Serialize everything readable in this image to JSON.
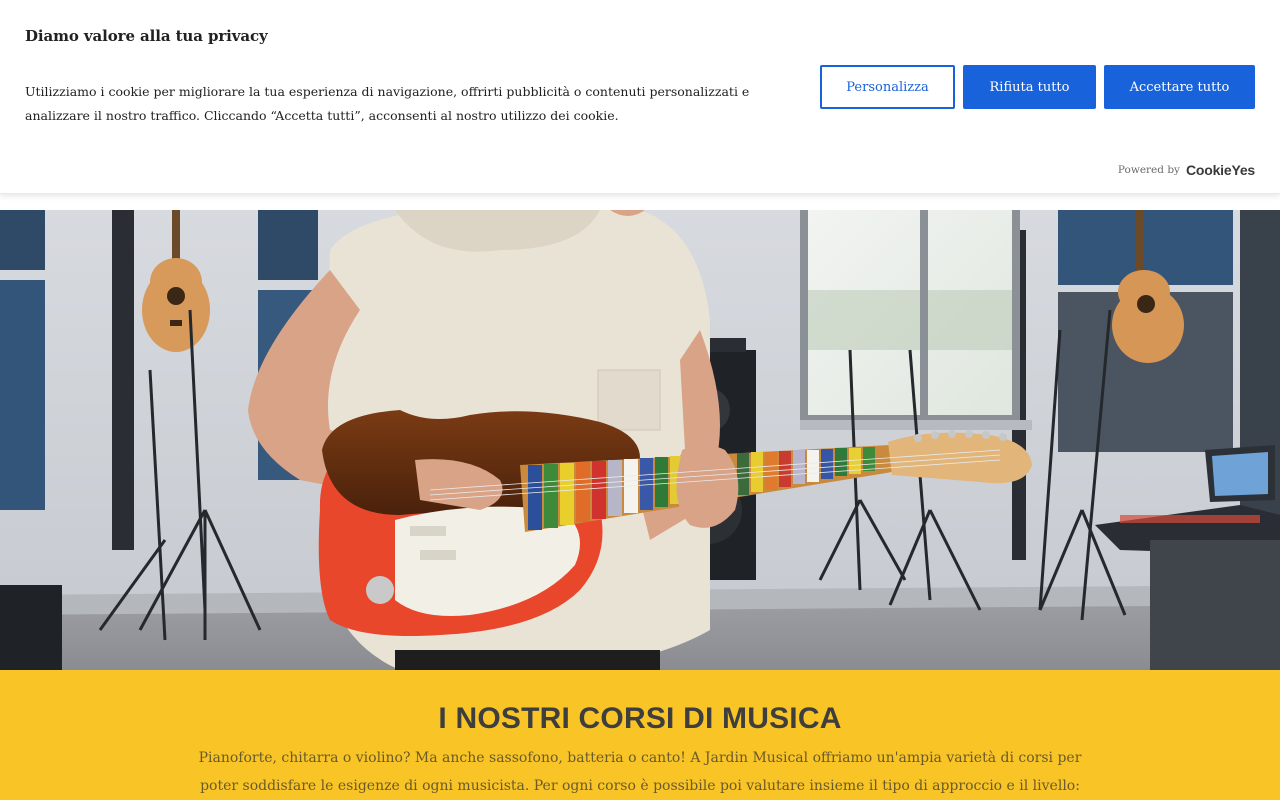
{
  "cookie_banner": {
    "title": "Diamo valore alla tua privacy",
    "text": "Utilizziamo i cookie per migliorare la tua esperienza di navigazione, offrirti pubblicità o contenuti personalizzati e analizzare il nostro traffico. Cliccando “Accetta tutti”, acconsenti al nostro utilizzo dei cookie.",
    "buttons": {
      "customize": "Personalizza",
      "reject_all": "Rifiuta tutto",
      "accept_all": "Accettare tutto"
    },
    "powered_by": "Powered by",
    "powered_brand": "CookieYes",
    "colors": {
      "primary": "#1863dc"
    }
  },
  "hero": {
    "image_subject": "music-studio-guitar-player"
  },
  "courses": {
    "title": "I NOSTRI CORSI DI MUSICA",
    "description": "Pianoforte, chitarra o violino? Ma anche sassofono, batteria o canto! A Jardin Musical offriamo un'ampia varietà di corsi per poter soddisfare le esigenze di ogni musicista. Per ogni corso è possibile poi valutare insieme il tipo di approccio e il livello: creiamo un",
    "background_color": "#f8c426"
  }
}
